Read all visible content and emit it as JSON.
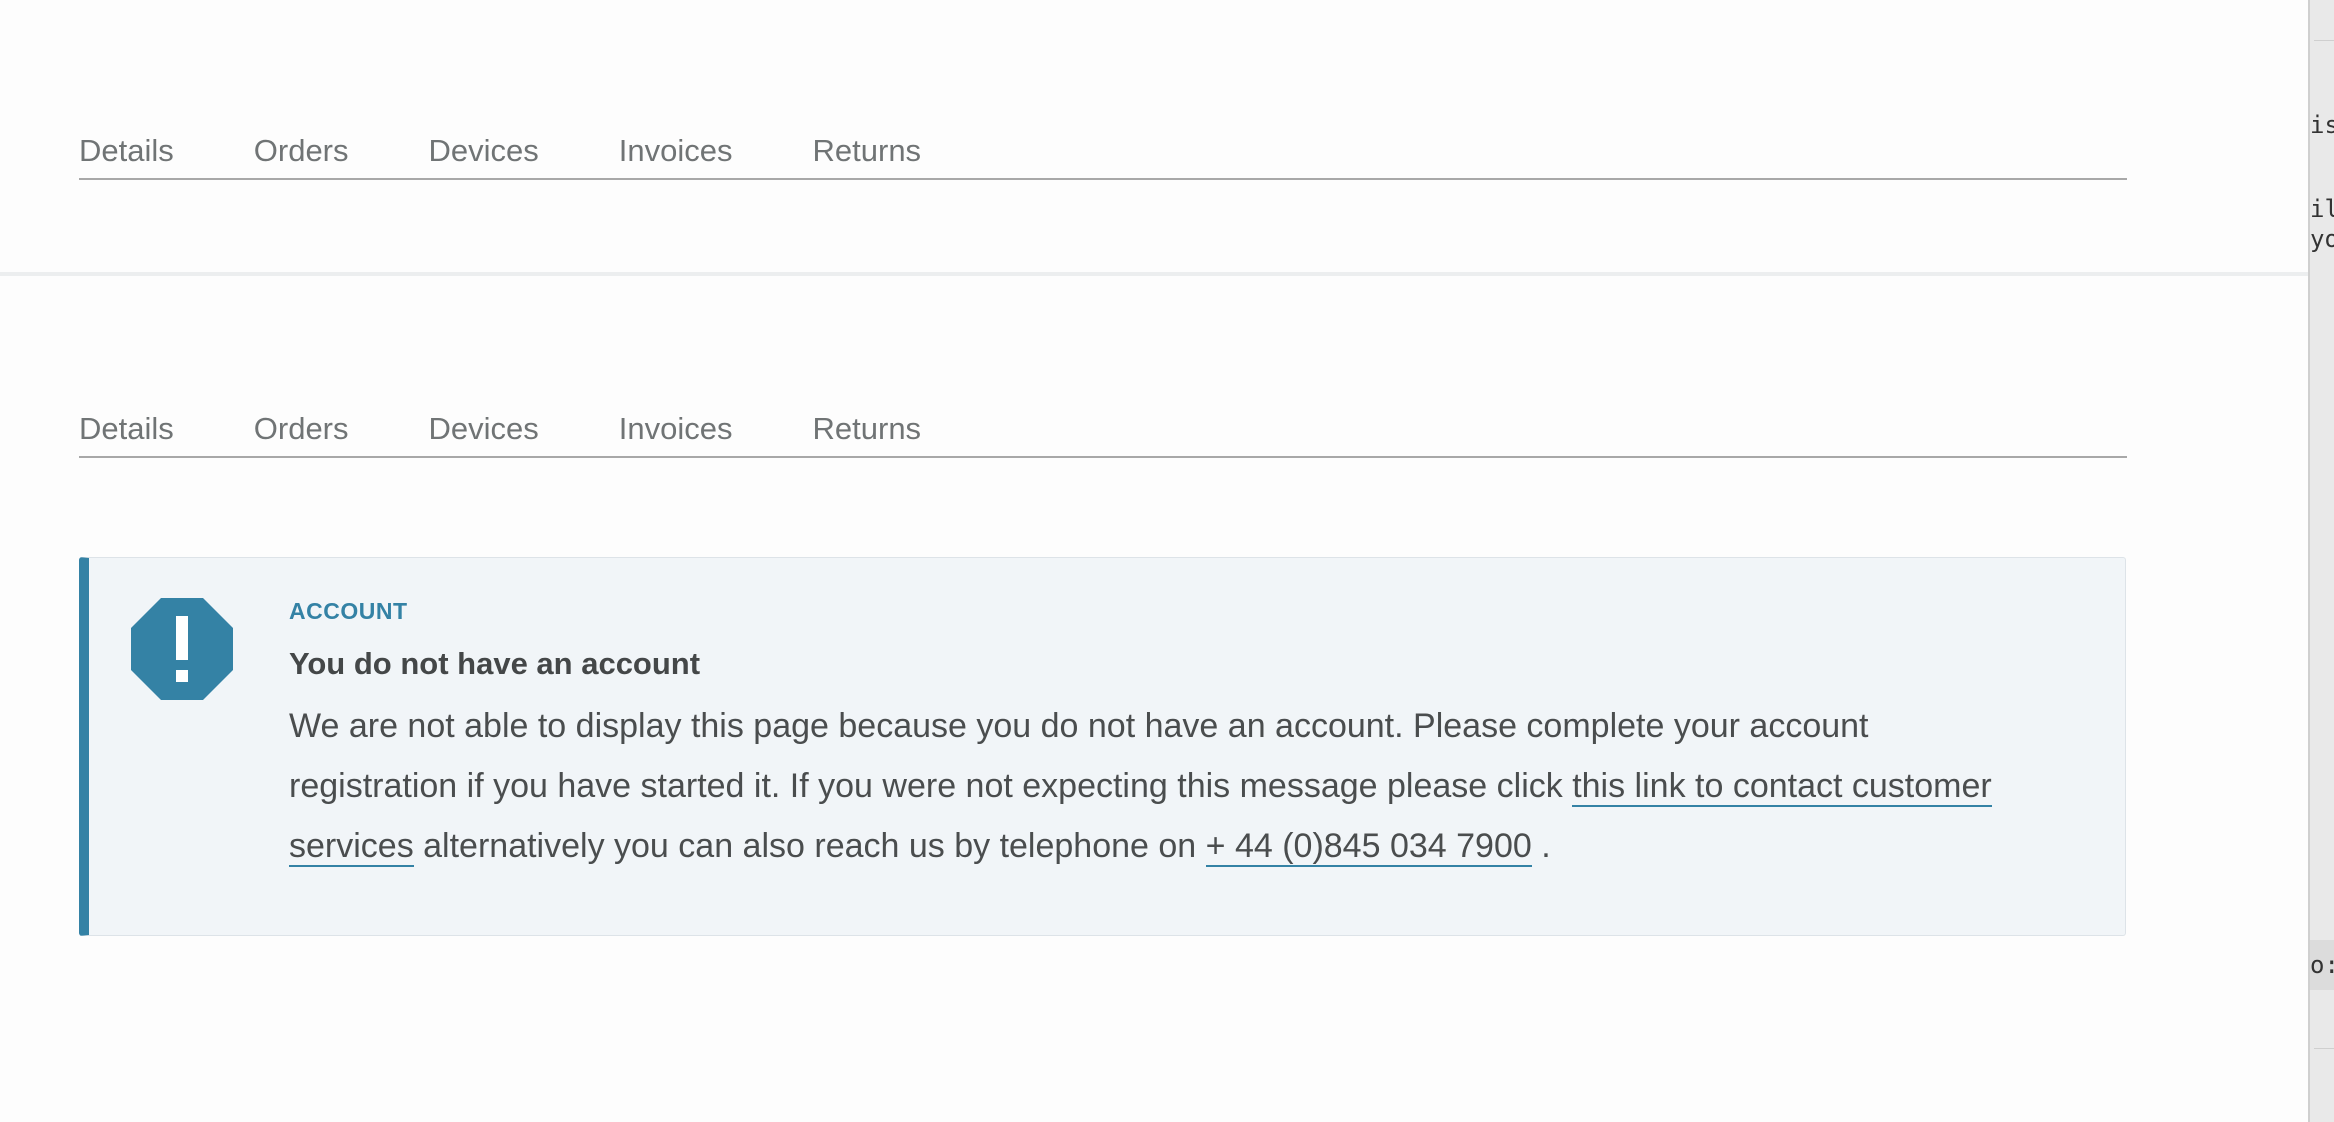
{
  "tabs_top": [
    "Details",
    "Orders",
    "Devices",
    "Invoices",
    "Returns"
  ],
  "tabs_bottom": [
    "Details",
    "Orders",
    "Devices",
    "Invoices",
    "Returns"
  ],
  "alert": {
    "label": "ACCOUNT",
    "title": "You do not have an account",
    "text_part1": "We are not able to display this page because you do not have an account. Please complete your account registration if you have started it. If you were not expecting this message please click ",
    "link_contact": "this link to contact customer services",
    "text_part2": " alternatively you can also reach us by telephone on ",
    "link_phone": "+ 44 (0)845 034 7900",
    "text_part3": " .",
    "icon": "exclamation-octagon-icon"
  },
  "side_panel": {
    "fragments": [
      "ist",
      "ill",
      "yo",
      "o:"
    ]
  },
  "colors": {
    "accent": "#3482a5",
    "alert_background": "#f1f5f8",
    "tab_text": "#707475",
    "body_text": "#4a4d4e"
  }
}
